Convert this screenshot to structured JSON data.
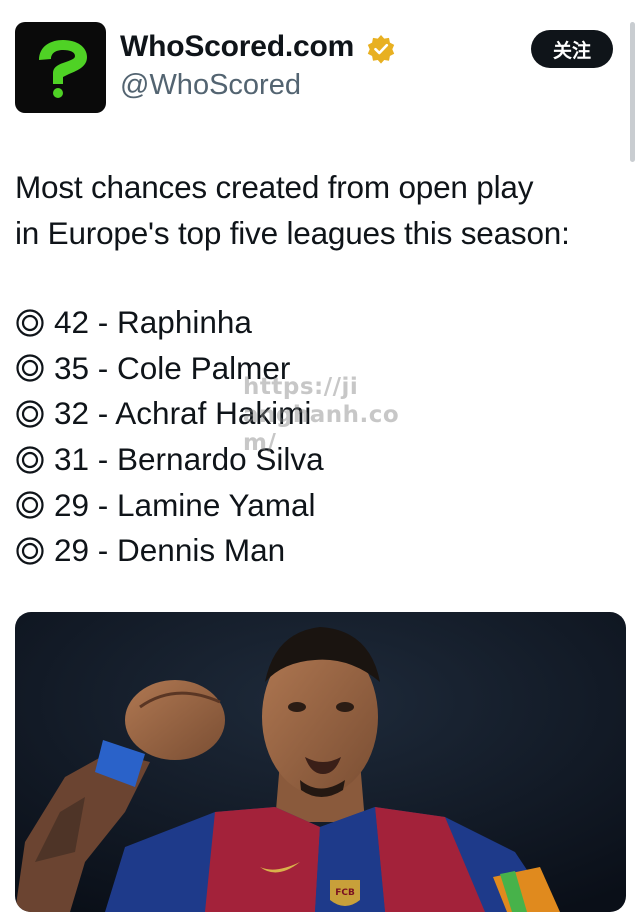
{
  "header": {
    "display_name": "WhoScored.com",
    "handle": "@WhoScored",
    "follow_label": "关注",
    "avatar_icon": "question-mark-logo",
    "verified_icon": "verified-badge-icon",
    "verified_color": "#e8b021",
    "logo_color": "#4fd225"
  },
  "tweet": {
    "text_line_1": "Most chances created from open play",
    "text_line_2": "in Europe's top five leagues this season:",
    "bullet_icon": "bullseye-icon",
    "rankings": [
      {
        "text": "42 - Raphinha"
      },
      {
        "text": "35 - Cole Palmer"
      },
      {
        "text": "32 - Achraf Hakimi"
      },
      {
        "text": "31 - Bernardo Silva"
      },
      {
        "text": "29 - Lamine Yamal"
      },
      {
        "text": "29 - Dennis Man"
      }
    ]
  },
  "watermark": {
    "line_1": "https://ji",
    "line_2": "anghanh.co",
    "line_3": "m/"
  },
  "media": {
    "description_icon": "player-photo",
    "shirt_badge": "FCB"
  }
}
